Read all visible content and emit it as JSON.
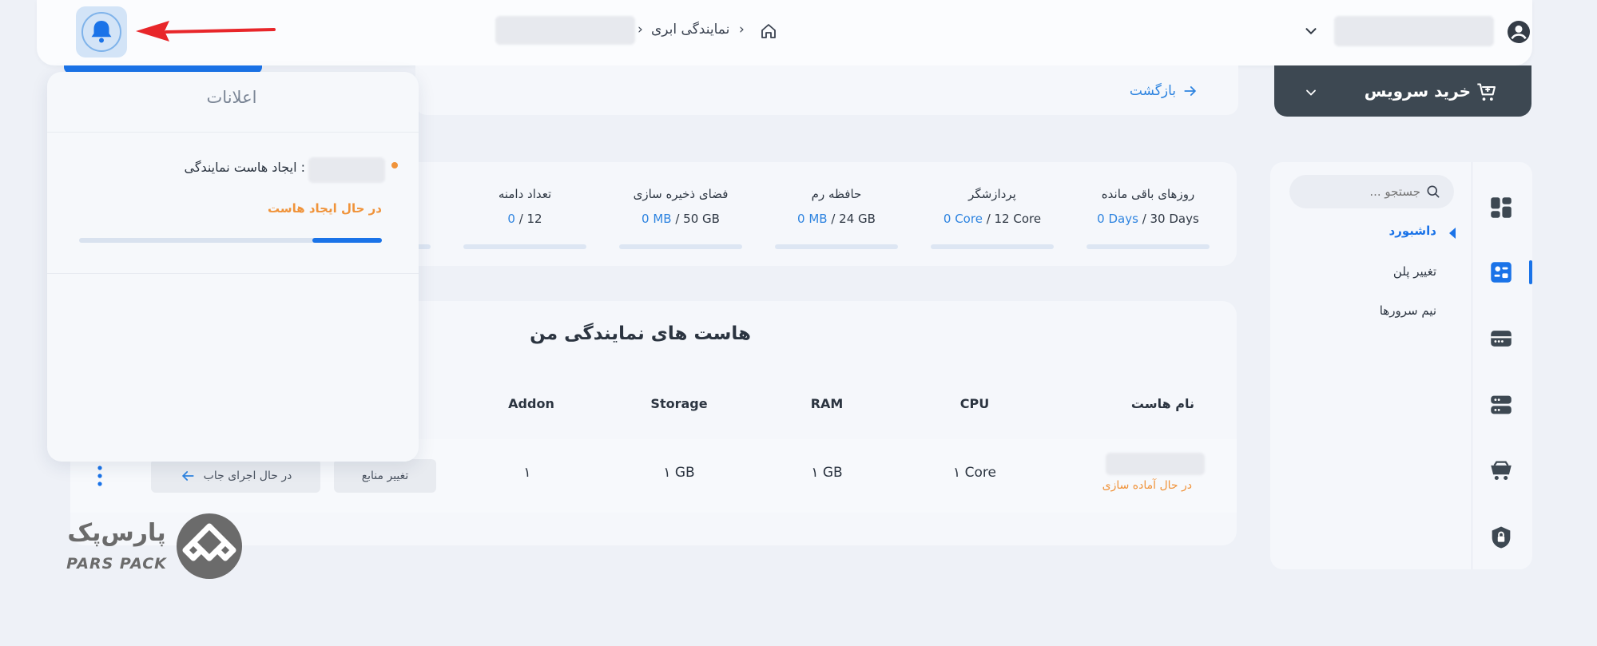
{
  "header": {
    "breadcrumb": {
      "separator_1": "›",
      "reseller_label": "نمایندگی ابری",
      "separator_2": "›"
    },
    "user_dropdown_icon": "chevron-down-icon",
    "user_icon": "account-circle-icon",
    "bell_icon": "bell-icon",
    "home_icon": "home-icon"
  },
  "subbar": {
    "back_label": "بازگشت"
  },
  "buy_service": {
    "label": "خرید سرویس"
  },
  "sidebar": {
    "search_placeholder": "جستجو ...",
    "items": [
      {
        "label": "داشبورد",
        "active": true
      },
      {
        "label": "تغییر پلن",
        "active": false
      },
      {
        "label": "نیم سرورها",
        "active": false
      }
    ],
    "rail_icons": [
      "dashboard-icon",
      "hosting-icon",
      "server-icon",
      "server-stack-icon",
      "cart-icon",
      "shield-icon"
    ]
  },
  "stats": [
    {
      "label": "روزهای باقی مانده",
      "used": "0 Days",
      "total": "30 Days",
      "used_fraction": 0
    },
    {
      "label": "پردازشگر",
      "used": "0 Core",
      "total": "12 Core",
      "used_fraction": 0
    },
    {
      "label": "حافظه رم",
      "used": "0 MB",
      "total": "24 GB",
      "used_fraction": 0
    },
    {
      "label": "فضای ذخیره سازی",
      "used": "0 MB",
      "total": "50 GB",
      "used_fraction": 0
    },
    {
      "label": "تعداد دامنه",
      "used": "0",
      "total": "12",
      "used_fraction": 0
    }
  ],
  "stat_sep": " / ",
  "hosts": {
    "title": "هاست های نمایندگی من",
    "columns": {
      "name": "نام هاست",
      "cpu": "CPU",
      "ram": "RAM",
      "storage": "Storage",
      "addon": "Addon"
    },
    "rows": [
      {
        "status": "در حال آماده سازی",
        "cpu": "۱ Core",
        "ram": "۱ GB",
        "storage": "۱ GB",
        "addon": "۱",
        "change_resources": "تغییر منابع",
        "job_running": "در حال اجرای جاب"
      }
    ]
  },
  "notifications": {
    "title": "اعلانات",
    "items": [
      {
        "text": ": ایجاد هاست نمایندگی",
        "status": "در حال ایجاد هاست",
        "progress": 0.23
      }
    ]
  },
  "logo": {
    "text_fa": "پارس‌پک",
    "text_en": "PARS PACK"
  },
  "colors": {
    "accent": "#2e84e0",
    "orange": "#f0933a",
    "dark": "#3d4852",
    "red_arrow": "#e8262a"
  }
}
